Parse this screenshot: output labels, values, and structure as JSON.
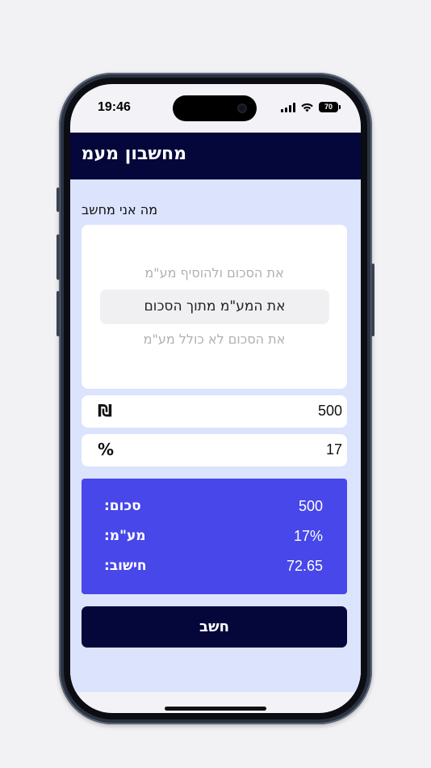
{
  "status_bar": {
    "time": "19:46",
    "battery": "70"
  },
  "navbar": {
    "title": "מחשבון מעמ"
  },
  "calculator": {
    "section_label": "מה אני מחשב",
    "options": [
      "את הסכום ולהוסיף מע\"מ",
      "את המע\"מ מתוך הסכום",
      "את הסכום לא כולל מע\"מ"
    ],
    "selected_index": 1,
    "amount": {
      "value": "500",
      "unit": "₪"
    },
    "vat": {
      "value": "17",
      "unit": "%"
    },
    "results": [
      {
        "label": "סכום:",
        "value": "500"
      },
      {
        "label": "מע\"מ:",
        "value": "17%"
      },
      {
        "label": "חישוב:",
        "value": "72.65"
      }
    ],
    "calc_button": "חשב"
  },
  "colors": {
    "navbar": "#05073b",
    "content_bg": "#dbe3fd",
    "result_bg": "#4747ea",
    "button_bg": "#05073b"
  }
}
